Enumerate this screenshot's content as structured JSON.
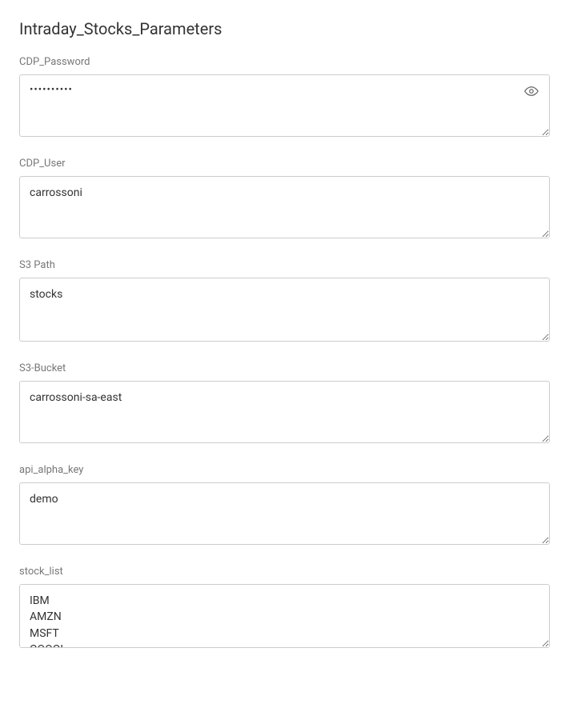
{
  "title": "Intraday_Stocks_Parameters",
  "fields": {
    "cdp_password": {
      "label": "CDP_Password",
      "value": "••••••••••"
    },
    "cdp_user": {
      "label": "CDP_User",
      "value": "carrossoni"
    },
    "s3_path": {
      "label": "S3 Path",
      "value": "stocks"
    },
    "s3_bucket": {
      "label": "S3-Bucket",
      "value": "carrossoni-sa-east"
    },
    "api_alpha_key": {
      "label": "api_alpha_key",
      "value": "demo"
    },
    "stock_list": {
      "label": "stock_list",
      "value": "IBM\nAMZN\nMSFT\nGOOGL"
    }
  }
}
